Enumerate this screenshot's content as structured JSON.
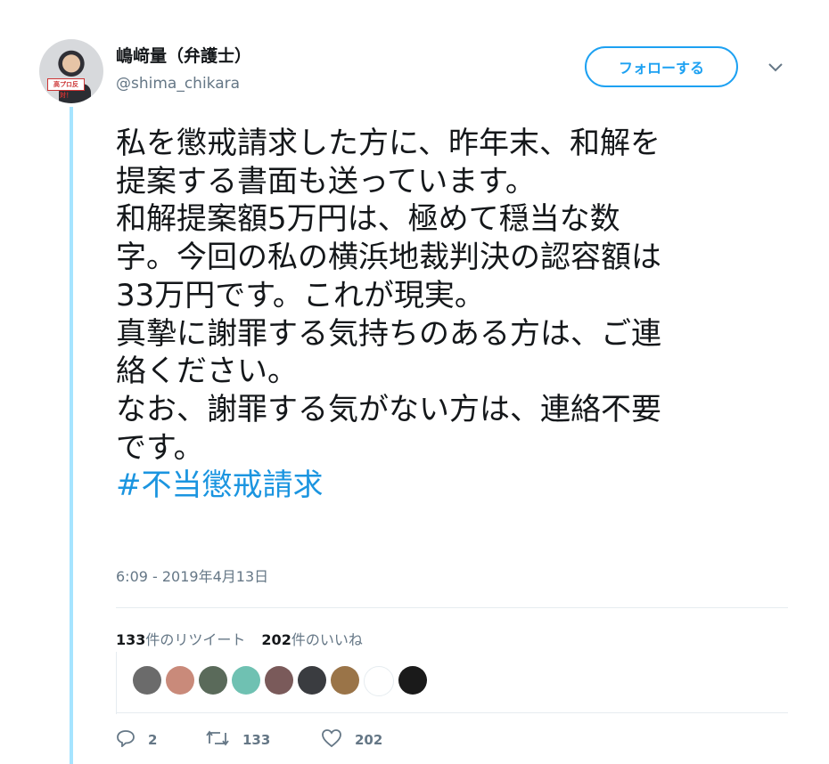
{
  "author": {
    "name": "嶋﨑量（弁護士）",
    "handle": "@shima_chikara",
    "avatar_sign": "高プロ反対！"
  },
  "follow_button": {
    "label": "フォローする"
  },
  "tweet": {
    "lines": [
      "私を懲戒請求した方に、昨年末、和解を",
      "提案する書面も送っています。",
      "和解提案額5万円は、極めて穏当な数",
      "字。今回の私の横浜地裁判決の認容額は",
      "33万円です。これが現実。",
      "真摯に謝罪する気持ちのある方は、ご連",
      "絡ください。",
      "なお、謝罪する気がない方は、連絡不要",
      "です。"
    ],
    "hashtag": "#不当懲戒請求",
    "timestamp": "6:09 - 2019年4月13日"
  },
  "stats": {
    "retweets_count": "133",
    "retweets_label": "件のリツイート",
    "likes_count": "202",
    "likes_label": "件のいいね"
  },
  "liker_avatars": [
    {
      "color": "#6b6b6b"
    },
    {
      "color": "#c98a7a"
    },
    {
      "color": "#5a6a5a"
    },
    {
      "color": "#6fc1b2"
    },
    {
      "color": "#7a5a5a"
    },
    {
      "color": "#3a3c40"
    },
    {
      "color": "#9a7448"
    },
    {
      "color": "#ffffff"
    },
    {
      "color": "#1a1a1a"
    }
  ],
  "actions": {
    "reply_count": "2",
    "retweet_count": "133",
    "like_count": "202"
  },
  "colors": {
    "accent": "#1da1f2",
    "hashtag": "#1b95e0",
    "thread_line": "#a6e4ff",
    "muted": "#657786"
  }
}
